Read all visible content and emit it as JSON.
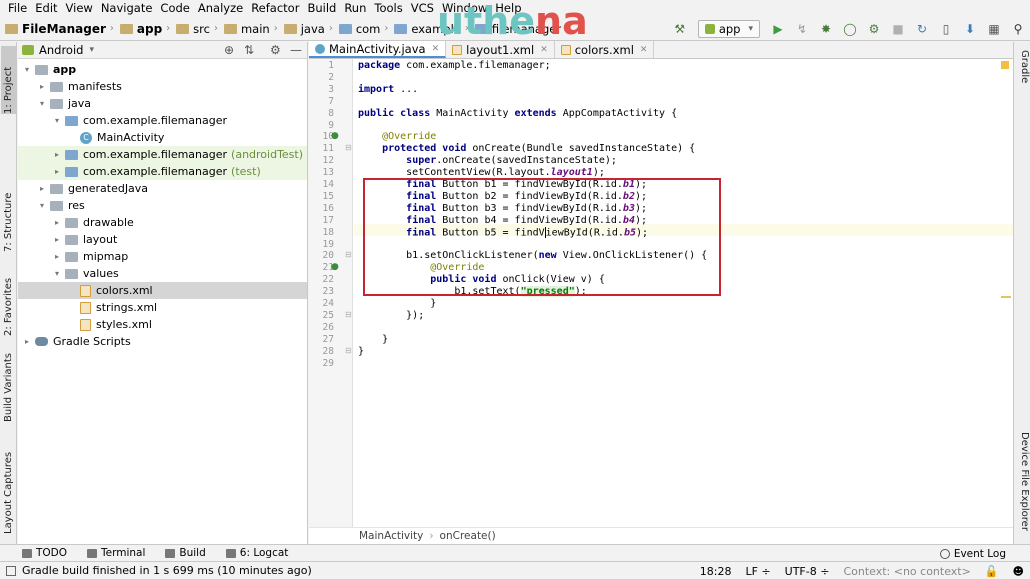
{
  "menu": [
    "File",
    "Edit",
    "View",
    "Navigate",
    "Code",
    "Analyze",
    "Refactor",
    "Build",
    "Run",
    "Tools",
    "VCS",
    "Window",
    "Help"
  ],
  "breadcrumbs": [
    {
      "label": "FileManager",
      "bold": true
    },
    {
      "label": "app",
      "bold": true
    },
    {
      "label": "src"
    },
    {
      "label": "main"
    },
    {
      "label": "java"
    },
    {
      "label": "com"
    },
    {
      "label": "example"
    },
    {
      "label": "filemanager"
    }
  ],
  "watermark": {
    "part1": "uthe",
    "part2": "na"
  },
  "run_config": "app",
  "left_tabs": {
    "project": "1: Project",
    "structure": "7: Structure",
    "favorites": "2: Favorites",
    "build_variants": "Build Variants",
    "layout_captures": "Layout Captures"
  },
  "right_tabs": {
    "gradle": "Gradle",
    "device_explorer": "Device File Explorer"
  },
  "project_panel": {
    "view": "Android"
  },
  "tree": [
    {
      "label": "app",
      "bold": true,
      "depth": 0,
      "arrow": "▾",
      "icon": "gray"
    },
    {
      "label": "manifests",
      "depth": 1,
      "arrow": "▸",
      "icon": "gray"
    },
    {
      "label": "java",
      "depth": 1,
      "arrow": "▾",
      "icon": "gray"
    },
    {
      "label": "com.example.filemanager",
      "depth": 2,
      "arrow": "▾",
      "icon": "blue"
    },
    {
      "label": "MainActivity",
      "depth": 3,
      "arrow": "",
      "icon": "cls"
    },
    {
      "label": "com.example.filemanager",
      "suffix": "(androidTest)",
      "depth": 2,
      "arrow": "▸",
      "icon": "blue",
      "tinted": true
    },
    {
      "label": "com.example.filemanager",
      "suffix": "(test)",
      "depth": 2,
      "arrow": "▸",
      "icon": "blue",
      "tinted": true
    },
    {
      "label": "generatedJava",
      "depth": 1,
      "arrow": "▸",
      "icon": "gray"
    },
    {
      "label": "res",
      "depth": 1,
      "arrow": "▾",
      "icon": "gray"
    },
    {
      "label": "drawable",
      "depth": 2,
      "arrow": "▸",
      "icon": "gray"
    },
    {
      "label": "layout",
      "depth": 2,
      "arrow": "▸",
      "icon": "gray"
    },
    {
      "label": "mipmap",
      "depth": 2,
      "arrow": "▸",
      "icon": "gray"
    },
    {
      "label": "values",
      "depth": 2,
      "arrow": "▾",
      "icon": "gray"
    },
    {
      "label": "colors.xml",
      "depth": 3,
      "arrow": "",
      "icon": "xml",
      "selected": true
    },
    {
      "label": "strings.xml",
      "depth": 3,
      "arrow": "",
      "icon": "xml"
    },
    {
      "label": "styles.xml",
      "depth": 3,
      "arrow": "",
      "icon": "xml"
    },
    {
      "label": "Gradle Scripts",
      "depth": 0,
      "arrow": "▸",
      "icon": "grad"
    }
  ],
  "editor_tabs": [
    {
      "label": "MainActivity.java",
      "icon": "cls",
      "active": true
    },
    {
      "label": "layout1.xml",
      "icon": "xml"
    },
    {
      "label": "colors.xml",
      "icon": "xml"
    }
  ],
  "code_lines": [
    {
      "n": "1",
      "html": "<span class=\"kw\">package</span> com.example.filemanager;"
    },
    {
      "n": "2",
      "html": ""
    },
    {
      "n": "3",
      "html": "<span class=\"kw\">import</span> ..."
    },
    {
      "n": "7",
      "html": ""
    },
    {
      "n": "8",
      "html": "<span class=\"kw\">public class</span> MainActivity <span class=\"kw\">extends</span> AppCompatActivity {"
    },
    {
      "n": "9",
      "html": ""
    },
    {
      "n": "10",
      "html": "    <span class=\"an\">@Override</span>"
    },
    {
      "n": "11",
      "html": "    <span class=\"kw\">protected void</span> onCreate(Bundle savedInstanceState) {"
    },
    {
      "n": "12",
      "html": "        <span class=\"kw\">super</span>.onCreate(savedInstanceState);"
    },
    {
      "n": "13",
      "html": "        setContentView(R.layout.<span class=\"fld\">layout1</span>);"
    },
    {
      "n": "14",
      "html": "        <span class=\"kw\">final</span> Button b1 = findViewById(R.id.<span class=\"fld\">b1</span>);"
    },
    {
      "n": "15",
      "html": "        <span class=\"kw\">final</span> Button b2 = findViewById(R.id.<span class=\"fld\">b2</span>);"
    },
    {
      "n": "16",
      "html": "        <span class=\"kw\">final</span> Button b3 = findViewById(R.id.<span class=\"fld\">b3</span>);"
    },
    {
      "n": "17",
      "html": "        <span class=\"kw\">final</span> Button b4 = findViewById(R.id.<span class=\"fld\">b4</span>);"
    },
    {
      "n": "18",
      "html": "        <span class=\"kw\">final</span> Button b5 = findV<span class=\"caret\"></span>iewById(R.id.<span class=\"fld\">b5</span>);"
    },
    {
      "n": "19",
      "html": ""
    },
    {
      "n": "20",
      "html": "        b1.setOnClickListener(<span class=\"kw\">new</span> View.OnClickListener() {"
    },
    {
      "n": "21",
      "html": "            <span class=\"an\">@Override</span>"
    },
    {
      "n": "22",
      "html": "            <span class=\"kw\">public void</span> onClick(View v) {"
    },
    {
      "n": "23",
      "html": "                b1.setText(<span class=\"str\">\"pressed\"</span>);"
    },
    {
      "n": "24",
      "html": "            }"
    },
    {
      "n": "25",
      "html": "        });"
    },
    {
      "n": "26",
      "html": ""
    },
    {
      "n": "27",
      "html": "    }"
    },
    {
      "n": "28",
      "html": "}"
    },
    {
      "n": "29",
      "html": ""
    }
  ],
  "editor_breadcrumb": [
    "MainActivity",
    "onCreate()"
  ],
  "tool_windows": [
    {
      "label": "TODO"
    },
    {
      "label": "Terminal"
    },
    {
      "label": "Build"
    },
    {
      "label": "6: Logcat"
    }
  ],
  "event_log": "Event Log",
  "status": {
    "message": "Gradle build finished in 1 s 699 ms (10 minutes ago)",
    "position": "18:28",
    "line_sep": "LF ÷",
    "encoding": "UTF-8 ÷",
    "context": "Context: <no context>"
  }
}
